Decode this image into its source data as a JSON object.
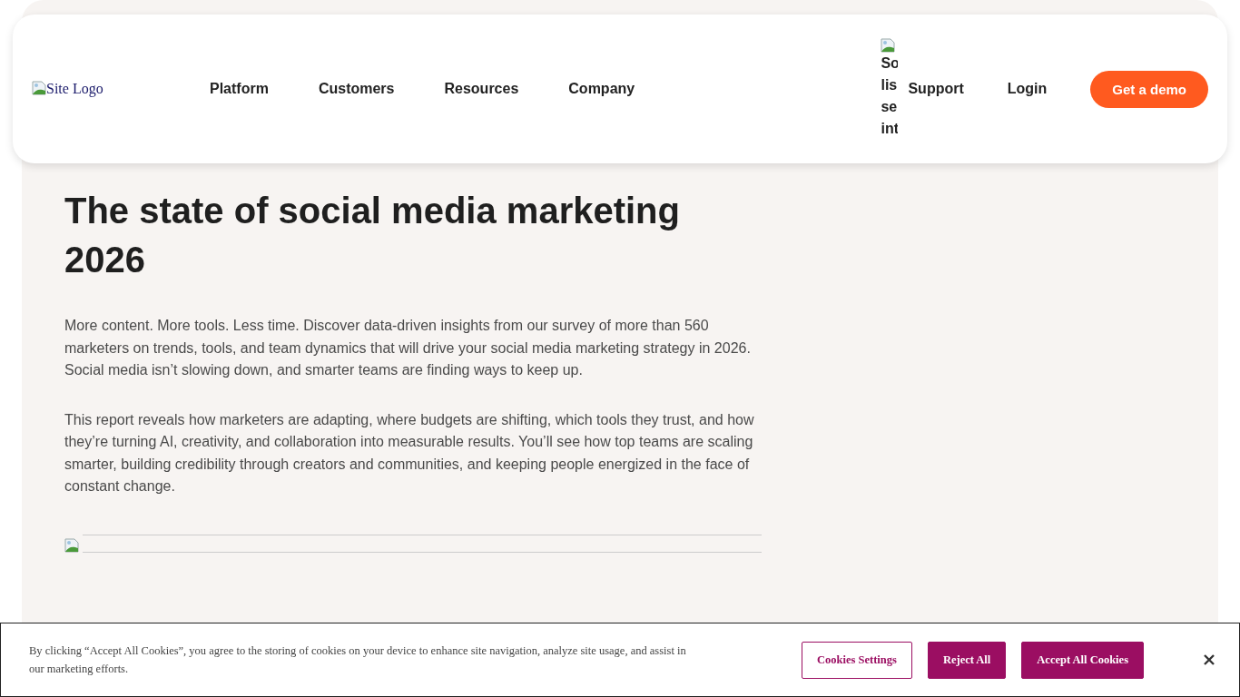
{
  "header": {
    "logo_alt": "Site Logo",
    "nav": [
      "Platform",
      "Customers",
      "Resources",
      "Company"
    ],
    "broken_image_alt_lines": [
      "So",
      "lis",
      "se",
      "int"
    ],
    "links": [
      "Support",
      "Login"
    ],
    "cta": "Get a demo"
  },
  "article": {
    "title": "The state of social media marketing 2026",
    "paragraphs": [
      "More content. More tools. Less time. Discover data-driven insights from our survey of more than 560 marketers on trends, tools, and team dynamics that will drive your social media marketing strategy in 2026. Social media isn’t slowing down, and smarter teams are finding ways to keep up.",
      "This report reveals how marketers are adapting, where budgets are shifting, which tools they trust, and how they’re turning AI, creativity, and collaboration into measurable results. You’ll see how top teams are scaling smarter, building credibility through creators and communities, and keeping people energized in the face of constant change."
    ]
  },
  "cookie_banner": {
    "text": "By clicking “Accept All Cookies”, you agree to the storing of cookies on your device to enhance site navigation, analyze site usage, and assist in our marketing efforts.",
    "buttons": [
      {
        "label": "Cookies Settings",
        "kind": "outline"
      },
      {
        "label": "Reject All",
        "kind": "filled"
      },
      {
        "label": "Accept All Cookies",
        "kind": "filled"
      }
    ]
  }
}
